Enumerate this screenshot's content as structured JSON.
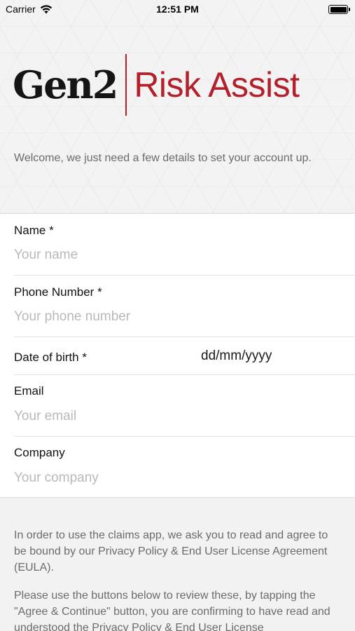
{
  "status_bar": {
    "carrier": "Carrier",
    "time": "12:51 PM"
  },
  "logo": {
    "brand": "Gen2",
    "product": "Risk Assist",
    "accent_color": "#b3202c"
  },
  "welcome_text": "Welcome, we just need a few details to set your account up.",
  "form": {
    "name": {
      "label": "Name *",
      "placeholder": "Your name"
    },
    "phone": {
      "label": "Phone Number *",
      "placeholder": "Your phone number"
    },
    "dob": {
      "label": "Date of birth *",
      "value": "dd/mm/yyyy"
    },
    "email": {
      "label": "Email",
      "placeholder": "Your email"
    },
    "company": {
      "label": "Company",
      "placeholder": "Your company"
    }
  },
  "legal": {
    "paragraph1": "In order to use the claims app, we ask you to read and agree to be bound by our Privacy Policy & End User License Agreement (EULA).",
    "paragraph2": "Please use the buttons below to review these, by tapping the \"Agree & Continue\" button, you are confirming to have read and understood the Privacy Policy & End User License"
  }
}
